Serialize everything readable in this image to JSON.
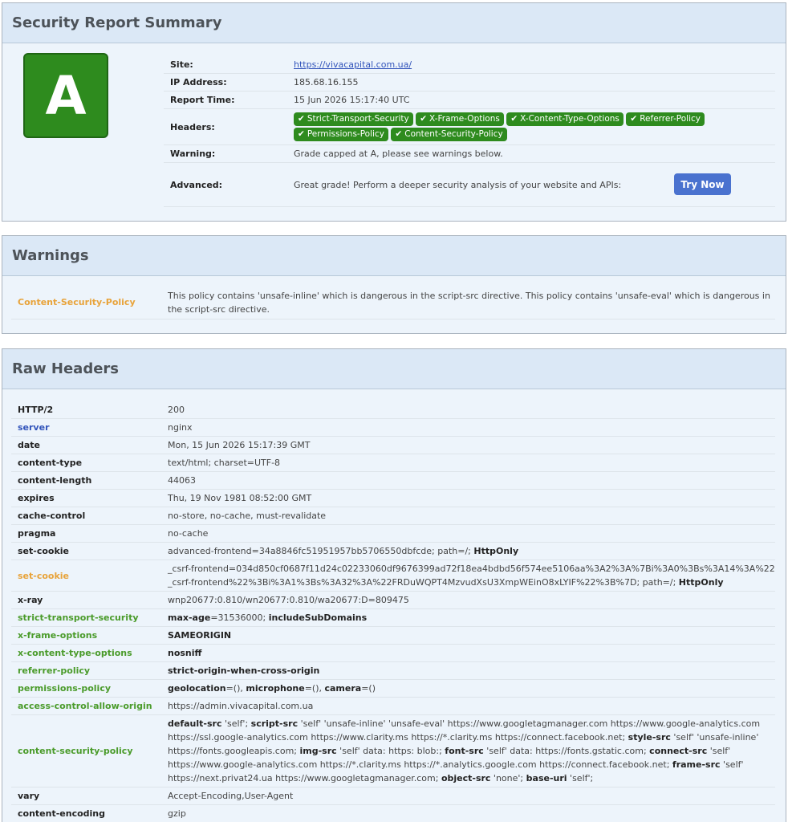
{
  "summary": {
    "title": "Security Report Summary",
    "grade": "A",
    "site_label": "Site:",
    "site_value": "https://vivacapital.com.ua/",
    "ip_label": "IP Address:",
    "ip_value": "185.68.16.155",
    "time_label": "Report Time:",
    "time_value": "15 Jun 2026 15:17:40 UTC",
    "headers_label": "Headers:",
    "headers": [
      "Strict-Transport-Security",
      "X-Frame-Options",
      "X-Content-Type-Options",
      "Referrer-Policy",
      "Permissions-Policy",
      "Content-Security-Policy"
    ],
    "warning_label": "Warning:",
    "warning_value": "Grade capped at A, please see warnings below.",
    "advanced_label": "Advanced:",
    "advanced_value": "Great grade! Perform a deeper security analysis of your website and APIs:",
    "try_label": "Try Now"
  },
  "warnings": {
    "title": "Warnings",
    "items": [
      {
        "key": "Content-Security-Policy",
        "text": "This policy contains 'unsafe-inline' which is dangerous in the script-src directive. This policy contains 'unsafe-eval' which is dangerous in the script-src directive."
      }
    ]
  },
  "raw": {
    "title": "Raw Headers",
    "rows": [
      {
        "k": "HTTP/2",
        "v": "200"
      },
      {
        "k": "server",
        "v": "nginx"
      },
      {
        "k": "date",
        "v": "Mon, 15 Jun 2026 15:17:39 GMT"
      },
      {
        "k": "content-type",
        "v": "text/html; charset=UTF-8"
      },
      {
        "k": "content-length",
        "v": "44063"
      },
      {
        "k": "expires",
        "v": "Thu, 19 Nov 1981 08:52:00 GMT"
      },
      {
        "k": "cache-control",
        "v": "no-store, no-cache, must-revalidate"
      },
      {
        "k": "pragma",
        "v": "no-cache"
      },
      {
        "k": "set-cookie",
        "v1": "advanced-frontend=34a8846fc51951957bb5706550dbfcde; path=/; ",
        "b1": "HttpOnly"
      },
      {
        "k": "set-cookie",
        "v1": "_csrf-frontend=034d850cf0687f11d24c02233060df9676399ad72f18ea4bdbd56f574ee5106aa%3A2%3A%7Bi%3A0%3Bs%3A14%3A%22_csrf-frontend%22%3Bi%3A1%3Bs%3A32%3A%22FRDuWQPT4MzvudXsU3XmpWEinO8xLYIF%22%3B%7D; path=/; ",
        "b1": "HttpOnly"
      },
      {
        "k": "x-ray",
        "v": "wnp20677:0.810/wn20677:0.810/wa20677:D=809475"
      },
      {
        "k": "strict-transport-security",
        "b1": "max-age",
        "v1": "=31536000; ",
        "b2": "includeSubDomains"
      },
      {
        "k": "x-frame-options",
        "b1": "SAMEORIGIN"
      },
      {
        "k": "x-content-type-options",
        "b1": "nosniff"
      },
      {
        "k": "referrer-policy",
        "b1": "strict-origin-when-cross-origin"
      },
      {
        "k": "permissions-policy",
        "b1": "geolocation",
        "v1": "=(), ",
        "b2": "microphone",
        "v2": "=(), ",
        "b3": "camera",
        "v3": "=()"
      },
      {
        "k": "access-control-allow-origin",
        "v": "https://admin.vivacapital.com.ua"
      },
      {
        "k": "content-security-policy",
        "csp": [
          {
            "b": "default-src",
            "t": " 'self'; "
          },
          {
            "b": "script-src",
            "t": " 'self' 'unsafe-inline' 'unsafe-eval' https://www.googletagmanager.com https://www.google-analytics.com https://ssl.google-analytics.com https://www.clarity.ms https://*.clarity.ms https://connect.facebook.net; "
          },
          {
            "b": "style-src",
            "t": " 'self' 'unsafe-inline' https://fonts.googleapis.com; "
          },
          {
            "b": "img-src",
            "t": " 'self' data: https: blob:; "
          },
          {
            "b": "font-src",
            "t": " 'self' data: https://fonts.gstatic.com; "
          },
          {
            "b": "connect-src",
            "t": " 'self' https://www.google-analytics.com https://*.clarity.ms https://*.analytics.google.com https://connect.facebook.net; "
          },
          {
            "b": "frame-src",
            "t": " 'self' https://next.privat24.ua https://www.googletagmanager.com; "
          },
          {
            "b": "object-src",
            "t": " 'none'; "
          },
          {
            "b": "base-uri",
            "t": " 'self';"
          }
        ]
      },
      {
        "k": "vary",
        "v": "Accept-Encoding,User-Agent"
      },
      {
        "k": "content-encoding",
        "v": "gzip"
      }
    ]
  }
}
